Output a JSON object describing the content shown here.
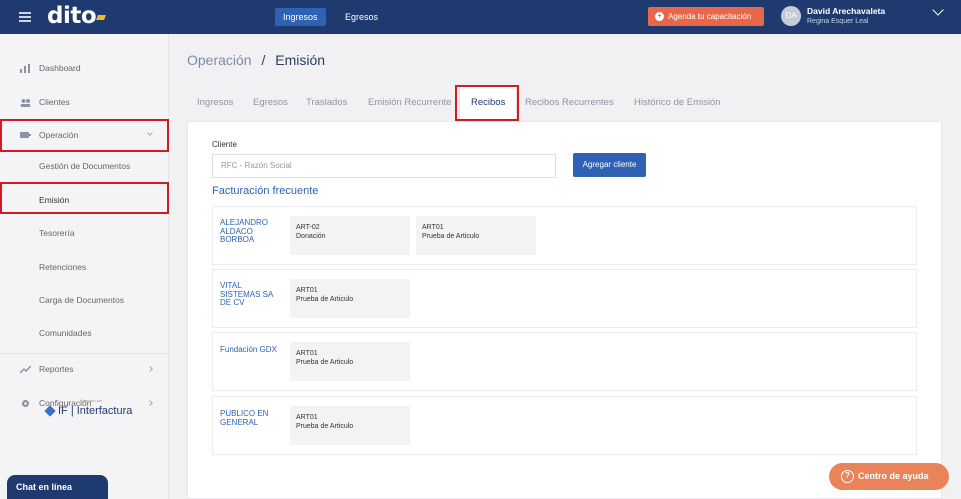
{
  "topbar": {
    "logo": "dito",
    "nav": [
      {
        "label": "Ingresos",
        "active": true
      },
      {
        "label": "Egresos",
        "active": false
      }
    ],
    "cta_label": "Agenda tu capacitación",
    "user": {
      "initials": "DA",
      "name": "David Arechavaleta",
      "subtitle": "Regina Esquer Leal"
    }
  },
  "sidebar": {
    "items": [
      {
        "label": "Dashboard",
        "icon": "bar-chart-icon"
      },
      {
        "label": "Clientes",
        "icon": "users-icon"
      },
      {
        "label": "Operación",
        "icon": "operation-icon",
        "expanded": true
      },
      {
        "label": "Reportes",
        "icon": "trend-icon"
      },
      {
        "label": "Configuración",
        "icon": "gear-icon"
      }
    ],
    "sub_items": [
      "Gestión de Documentos",
      "Emisión",
      "Tesorería",
      "Retenciones",
      "Carga de Documentos",
      "Comunidades"
    ],
    "brand_prefix": "Operado por",
    "brand": "IF | Interfactura",
    "chat_label": "Chat en línea"
  },
  "breadcrumb": {
    "parent": "Operación",
    "separator": "/",
    "current": "Emisión"
  },
  "tabs": [
    {
      "label": "Ingresos"
    },
    {
      "label": "Egresos"
    },
    {
      "label": "Traslados"
    },
    {
      "label": "Emisión Recurrente"
    },
    {
      "label": "Recibos",
      "active": true
    },
    {
      "label": "Recibos Recurrentes"
    },
    {
      "label": "Histórico de Emisión"
    }
  ],
  "form": {
    "client_label": "Cliente",
    "client_placeholder": "RFC - Razón Social",
    "add_button": "Agregar cliente"
  },
  "frequent": {
    "title": "Facturación frecuente",
    "clients": [
      {
        "name": "ALEJANDRO ALDACO BORBOA",
        "articles": [
          {
            "code": "ART-02",
            "desc": "Donación"
          },
          {
            "code": "ART01",
            "desc": "Prueba de Articulo"
          }
        ]
      },
      {
        "name": "VITAL SISTEMAS SA DE CV",
        "articles": [
          {
            "code": "ART01",
            "desc": "Prueba de Articulo"
          }
        ]
      },
      {
        "name": "Fundación GDX",
        "articles": [
          {
            "code": "ART01",
            "desc": "Prueba de Articulo"
          }
        ]
      },
      {
        "name": "PUBLICO EN GENERAL",
        "articles": [
          {
            "code": "ART01",
            "desc": "Prueba de Articulo"
          }
        ]
      }
    ]
  },
  "help_label": "Centro de ayuda",
  "colors": {
    "navy": "#1f3a6e",
    "accent": "#2f62b5",
    "cta": "#e8674a",
    "highlight": "#d01c24"
  }
}
